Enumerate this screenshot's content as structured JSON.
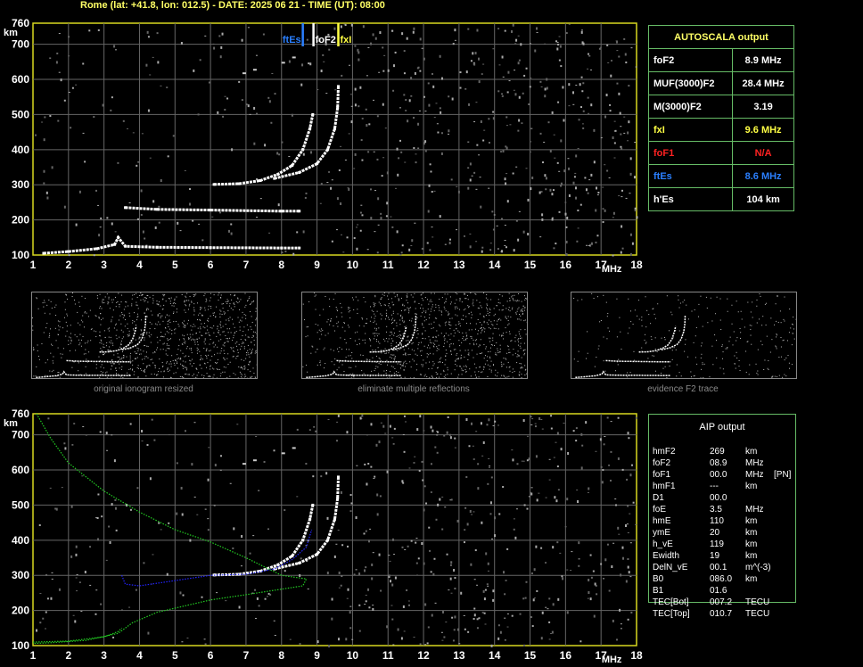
{
  "header": "Rome (lat: +41.8, lon: 012.5) - DATE: 2025 06 21 - TIME (UT): 08:00",
  "axes": {
    "y_unit": "km",
    "x_unit": "MHz",
    "y_ticks": [
      "100",
      "200",
      "300",
      "400",
      "500",
      "600",
      "700",
      "760"
    ],
    "x_ticks": [
      "1",
      "2",
      "3",
      "4",
      "5",
      "6",
      "7",
      "8",
      "9",
      "10",
      "11",
      "12",
      "13",
      "14",
      "15",
      "16",
      "17",
      "18"
    ]
  },
  "markers": [
    {
      "label": "ftEs",
      "freq": 8.6,
      "color": "#2a7fff"
    },
    {
      "label": "foF2",
      "freq": 8.9,
      "color": "#ffffff"
    },
    {
      "label": "fxI",
      "freq": 9.6,
      "color": "#ffff44"
    }
  ],
  "autoscala": {
    "title": "AUTOSCALA output",
    "rows": [
      {
        "label": "foF2",
        "value": "8.9 MHz",
        "color": "#ffffff"
      },
      {
        "label": "MUF(3000)F2",
        "value": "28.4 MHz",
        "color": "#ffffff"
      },
      {
        "label": "M(3000)F2",
        "value": "3.19",
        "color": "#ffffff"
      },
      {
        "label": "fxI",
        "value": "9.6 MHz",
        "color": "#ffff44"
      },
      {
        "label": "foF1",
        "value": "N/A",
        "color": "#ff2222"
      },
      {
        "label": "ftEs",
        "value": "8.6 MHz",
        "color": "#2a7fff"
      },
      {
        "label": "h'Es",
        "value": "104    km",
        "color": "#ffffff"
      }
    ]
  },
  "thumbnails": [
    {
      "caption": "original ionogram resized"
    },
    {
      "caption": "eliminate multiple reflections"
    },
    {
      "caption": "evidence F2 trace"
    }
  ],
  "aip": {
    "title": "AIP output",
    "rows": [
      {
        "name": "hmF2",
        "value": "269",
        "unit": "km",
        "extra": ""
      },
      {
        "name": "foF2",
        "value": "08.9",
        "unit": "MHz",
        "extra": ""
      },
      {
        "name": "foF1",
        "value": "00.0",
        "unit": "MHz",
        "extra": "[PN]"
      },
      {
        "name": "hmF1",
        "value": "---",
        "unit": "km",
        "extra": ""
      },
      {
        "name": "D1",
        "value": "00.0",
        "unit": "",
        "extra": ""
      },
      {
        "name": "foE",
        "value": "3.5",
        "unit": "MHz",
        "extra": ""
      },
      {
        "name": "hmE",
        "value": "110",
        "unit": "km",
        "extra": ""
      },
      {
        "name": "ymE",
        "value": "20",
        "unit": "km",
        "extra": ""
      },
      {
        "name": "h_vE",
        "value": "119",
        "unit": "km",
        "extra": ""
      },
      {
        "name": "Ewidth",
        "value": "19",
        "unit": "km",
        "extra": ""
      },
      {
        "name": "DelN_vE",
        "value": "00.1",
        "unit": "m^(-3)",
        "extra": ""
      },
      {
        "name": "B0",
        "value": "086.0",
        "unit": "km",
        "extra": ""
      },
      {
        "name": "B1",
        "value": "01.6",
        "unit": "",
        "extra": ""
      },
      {
        "name": "TEC[Bot]",
        "value": "007.2",
        "unit": "TECU",
        "extra": ""
      },
      {
        "name": "TEC[Top]",
        "value": "010.7",
        "unit": "TECU",
        "extra": ""
      }
    ]
  },
  "chart_data": [
    {
      "type": "scatter",
      "xlim": [
        1,
        18
      ],
      "ylim": [
        100,
        760
      ],
      "xlabel": "MHz",
      "ylabel": "km",
      "series": [
        {
          "name": "F2 o-trace",
          "points": [
            [
              6.1,
              301
            ],
            [
              6.8,
              303
            ],
            [
              7.4,
              312
            ],
            [
              7.9,
              330
            ],
            [
              8.3,
              355
            ],
            [
              8.6,
              400
            ],
            [
              8.8,
              460
            ],
            [
              8.88,
              500
            ]
          ]
        },
        {
          "name": "F2 x-trace",
          "points": [
            [
              7.8,
              318
            ],
            [
              8.5,
              335
            ],
            [
              9.0,
              360
            ],
            [
              9.3,
              400
            ],
            [
              9.5,
              460
            ],
            [
              9.58,
              520
            ],
            [
              9.6,
              580
            ]
          ]
        },
        {
          "name": "E trace",
          "points": [
            [
              1.3,
              105
            ],
            [
              2.0,
              110
            ],
            [
              2.8,
              118
            ],
            [
              3.3,
              130
            ],
            [
              3.4,
              150
            ],
            [
              3.6,
              125
            ],
            [
              4.5,
              122
            ],
            [
              6,
              121
            ],
            [
              8,
              120
            ],
            [
              8.5,
              120
            ]
          ]
        },
        {
          "name": "Es multiple",
          "points": [
            [
              3.6,
              235
            ],
            [
              4.5,
              230
            ],
            [
              6,
              228
            ],
            [
              8,
              225
            ],
            [
              8.5,
              225
            ]
          ]
        }
      ]
    },
    {
      "type": "line",
      "xlim": [
        1,
        18
      ],
      "ylim": [
        100,
        760
      ],
      "xlabel": "MHz",
      "ylabel": "km",
      "series": [
        {
          "name": "F2 o-trace",
          "points": [
            [
              6.1,
              301
            ],
            [
              6.8,
              303
            ],
            [
              7.4,
              312
            ],
            [
              7.9,
              330
            ],
            [
              8.3,
              355
            ],
            [
              8.6,
              400
            ],
            [
              8.8,
              460
            ],
            [
              8.88,
              500
            ]
          ]
        },
        {
          "name": "F2 x-trace",
          "points": [
            [
              7.8,
              318
            ],
            [
              8.5,
              335
            ],
            [
              9.0,
              360
            ],
            [
              9.3,
              400
            ],
            [
              9.5,
              460
            ],
            [
              9.58,
              520
            ],
            [
              9.6,
              580
            ]
          ]
        },
        {
          "name": "",
          "color": "#2222ff",
          "points": [
            [
              3.5,
              300
            ],
            [
              3.6,
              275
            ],
            [
              4.0,
              270
            ],
            [
              5,
              285
            ],
            [
              6,
              300
            ],
            [
              7,
              303
            ],
            [
              7.8,
              318
            ],
            [
              8.3,
              345
            ],
            [
              8.7,
              380
            ],
            [
              8.85,
              430
            ]
          ]
        },
        {
          "name": "",
          "color": "#22cc22",
          "points": [
            [
              1.1,
              760
            ],
            [
              1.5,
              690
            ],
            [
              2,
              620
            ],
            [
              3,
              540
            ],
            [
              4,
              480
            ],
            [
              5,
              430
            ],
            [
              6,
              395
            ],
            [
              7,
              350
            ],
            [
              8,
              300
            ],
            [
              8.7,
              290
            ],
            [
              8.6,
              270
            ],
            [
              7,
              245
            ],
            [
              6,
              230
            ],
            [
              4.5,
              195
            ],
            [
              3.8,
              165
            ],
            [
              3.4,
              135
            ],
            [
              2.5,
              115
            ],
            [
              1.5,
              108
            ],
            [
              1,
              106
            ]
          ]
        },
        {
          "name": "",
          "color": "#22cc22",
          "points": [
            [
              1,
              110
            ],
            [
              2,
              113
            ],
            [
              3,
              125
            ],
            [
              3.4,
              140
            ],
            [
              3.5,
              150
            ]
          ]
        }
      ]
    }
  ]
}
